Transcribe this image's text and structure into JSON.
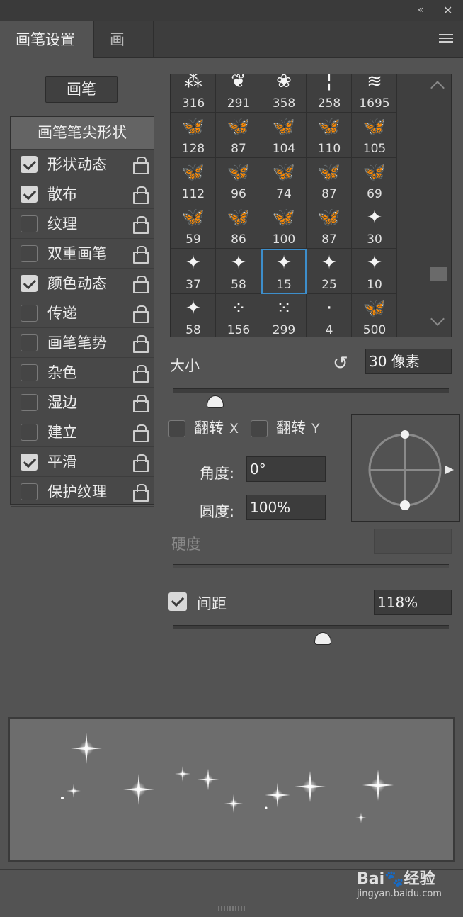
{
  "window": {
    "collapse_glyph": "‹‹",
    "close_glyph": "✕"
  },
  "tabs": [
    {
      "label": "画笔设置"
    },
    {
      "label": "画笔"
    }
  ],
  "brush_button": {
    "label": "画笔"
  },
  "options": {
    "header": "画笔笔尖形状",
    "items": [
      {
        "label": "形状动态",
        "checked": true
      },
      {
        "label": "散布",
        "checked": true
      },
      {
        "label": "纹理",
        "checked": false
      },
      {
        "label": "双重画笔",
        "checked": false
      },
      {
        "label": "颜色动态",
        "checked": true
      },
      {
        "label": "传递",
        "checked": false
      },
      {
        "label": "画笔笔势",
        "checked": false
      },
      {
        "label": "杂色",
        "checked": false
      },
      {
        "label": "湿边",
        "checked": false
      },
      {
        "label": "建立",
        "checked": false
      },
      {
        "label": "平滑",
        "checked": true
      },
      {
        "label": "保护纹理",
        "checked": false
      }
    ]
  },
  "brush_grid": {
    "selected_index": 22,
    "cells": [
      {
        "size": "316",
        "glyph": "⁂"
      },
      {
        "size": "291",
        "glyph": "❦"
      },
      {
        "size": "358",
        "glyph": "❀"
      },
      {
        "size": "258",
        "glyph": "¦"
      },
      {
        "size": "1695",
        "glyph": "≋"
      },
      {
        "size": "128",
        "glyph": "🦋"
      },
      {
        "size": "87",
        "glyph": "🦋"
      },
      {
        "size": "104",
        "glyph": "🦋"
      },
      {
        "size": "110",
        "glyph": "🦋"
      },
      {
        "size": "105",
        "glyph": "🦋"
      },
      {
        "size": "112",
        "glyph": "🦋"
      },
      {
        "size": "96",
        "glyph": "🦋"
      },
      {
        "size": "74",
        "glyph": "🦋"
      },
      {
        "size": "87",
        "glyph": "🦋"
      },
      {
        "size": "69",
        "glyph": "🦋"
      },
      {
        "size": "59",
        "glyph": "🦋"
      },
      {
        "size": "86",
        "glyph": "🦋"
      },
      {
        "size": "100",
        "glyph": "🦋"
      },
      {
        "size": "87",
        "glyph": "🦋"
      },
      {
        "size": "30",
        "glyph": "✦"
      },
      {
        "size": "37",
        "glyph": "✦"
      },
      {
        "size": "58",
        "glyph": "✦"
      },
      {
        "size": "15",
        "glyph": "✦"
      },
      {
        "size": "25",
        "glyph": "✦"
      },
      {
        "size": "10",
        "glyph": "✦"
      },
      {
        "size": "58",
        "glyph": "✦"
      },
      {
        "size": "156",
        "glyph": "⁘"
      },
      {
        "size": "299",
        "glyph": "⁙"
      },
      {
        "size": "4",
        "glyph": "·"
      },
      {
        "size": "500",
        "glyph": "🦋"
      }
    ]
  },
  "size": {
    "label": "大小",
    "value": "30 像素",
    "slider_fraction": 0.15
  },
  "flip_x": {
    "label": "翻转",
    "axis": "X",
    "checked": false
  },
  "flip_y": {
    "label": "翻转",
    "axis": "Y",
    "checked": false
  },
  "angle": {
    "label": "角度:",
    "value": "0°"
  },
  "roundness": {
    "label": "圆度:",
    "value": "100%"
  },
  "hardness": {
    "label": "硬度",
    "value": ""
  },
  "spacing": {
    "label": "间距",
    "value": "118%",
    "checked": true,
    "slider_fraction": 0.54
  },
  "watermark": {
    "main": "Bai🐾经验",
    "sub": "jingyan.baidu.com"
  },
  "icons": {
    "reset": "↺",
    "menu": "menu-icon",
    "lock": "lock-icon"
  }
}
